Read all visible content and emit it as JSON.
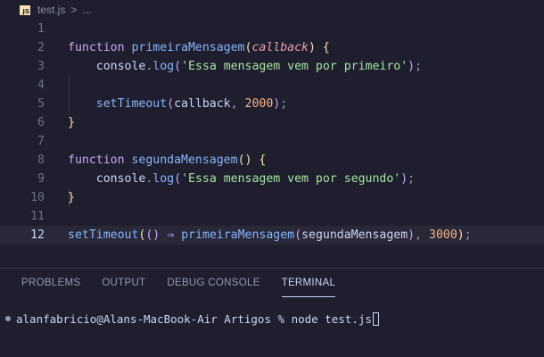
{
  "breadcrumb": {
    "badge": "JS",
    "file": "test.js",
    "separator": ">",
    "more": "..."
  },
  "editor": {
    "active_line": 12,
    "lines": [
      {
        "n": "1",
        "tokens": []
      },
      {
        "n": "2",
        "tokens": [
          {
            "t": "function ",
            "c": "kw"
          },
          {
            "t": "primeiraMensagem",
            "c": "fn"
          },
          {
            "t": "(",
            "c": "br1"
          },
          {
            "t": "callback",
            "c": "param"
          },
          {
            "t": ")",
            "c": "br1"
          },
          {
            "t": " ",
            "c": "plain"
          },
          {
            "t": "{",
            "c": "br1"
          }
        ]
      },
      {
        "n": "3",
        "tokens": [
          {
            "t": "    console",
            "c": "plain"
          },
          {
            "t": ".",
            "c": "punc"
          },
          {
            "t": "log",
            "c": "fn"
          },
          {
            "t": "(",
            "c": "br2"
          },
          {
            "t": "'Essa mensagem vem por primeiro'",
            "c": "str"
          },
          {
            "t": ")",
            "c": "br2"
          },
          {
            "t": ";",
            "c": "punc"
          }
        ]
      },
      {
        "n": "4",
        "tokens": []
      },
      {
        "n": "5",
        "tokens": [
          {
            "t": "    setTimeout",
            "c": "fn"
          },
          {
            "t": "(",
            "c": "br2"
          },
          {
            "t": "callback",
            "c": "plain"
          },
          {
            "t": ", ",
            "c": "punc"
          },
          {
            "t": "2000",
            "c": "num"
          },
          {
            "t": ")",
            "c": "br2"
          },
          {
            "t": ";",
            "c": "punc"
          }
        ]
      },
      {
        "n": "6",
        "tokens": [
          {
            "t": "}",
            "c": "br1"
          }
        ]
      },
      {
        "n": "7",
        "tokens": []
      },
      {
        "n": "8",
        "tokens": [
          {
            "t": "function ",
            "c": "kw"
          },
          {
            "t": "segundaMensagem",
            "c": "fn"
          },
          {
            "t": "()",
            "c": "br1"
          },
          {
            "t": " ",
            "c": "plain"
          },
          {
            "t": "{",
            "c": "br1"
          }
        ]
      },
      {
        "n": "9",
        "tokens": [
          {
            "t": "    console",
            "c": "plain"
          },
          {
            "t": ".",
            "c": "punc"
          },
          {
            "t": "log",
            "c": "fn"
          },
          {
            "t": "(",
            "c": "br2"
          },
          {
            "t": "'Essa mensagem vem por segundo'",
            "c": "str"
          },
          {
            "t": ")",
            "c": "br2"
          },
          {
            "t": ";",
            "c": "punc"
          }
        ]
      },
      {
        "n": "10",
        "tokens": [
          {
            "t": "}",
            "c": "br1"
          }
        ]
      },
      {
        "n": "11",
        "tokens": []
      },
      {
        "n": "12",
        "tokens": [
          {
            "t": "setTimeout",
            "c": "fn"
          },
          {
            "t": "(",
            "c": "br1"
          },
          {
            "t": "()",
            "c": "br2"
          },
          {
            "t": " ⇒ ",
            "c": "kw"
          },
          {
            "t": "primeiraMensagem",
            "c": "fn"
          },
          {
            "t": "(",
            "c": "br2"
          },
          {
            "t": "segundaMensagem",
            "c": "plain"
          },
          {
            "t": ")",
            "c": "br2"
          },
          {
            "t": ", ",
            "c": "punc"
          },
          {
            "t": "3000",
            "c": "num"
          },
          {
            "t": ")",
            "c": "br1"
          },
          {
            "t": ";",
            "c": "punc"
          }
        ]
      }
    ]
  },
  "panel": {
    "tabs": [
      {
        "label": "PROBLEMS",
        "active": false
      },
      {
        "label": "OUTPUT",
        "active": false
      },
      {
        "label": "DEBUG CONSOLE",
        "active": false
      },
      {
        "label": "TERMINAL",
        "active": true
      }
    ],
    "terminal": {
      "prompt": "alanfabricio@Alans-MacBook-Air Artigos % ",
      "command": "node test.js"
    }
  },
  "colors": {
    "background": "#1e1e2e",
    "keyword": "#cba6f7",
    "function": "#89b4fa",
    "string": "#a6e3a1",
    "number": "#fab387",
    "parameter": "#eba0ac"
  }
}
